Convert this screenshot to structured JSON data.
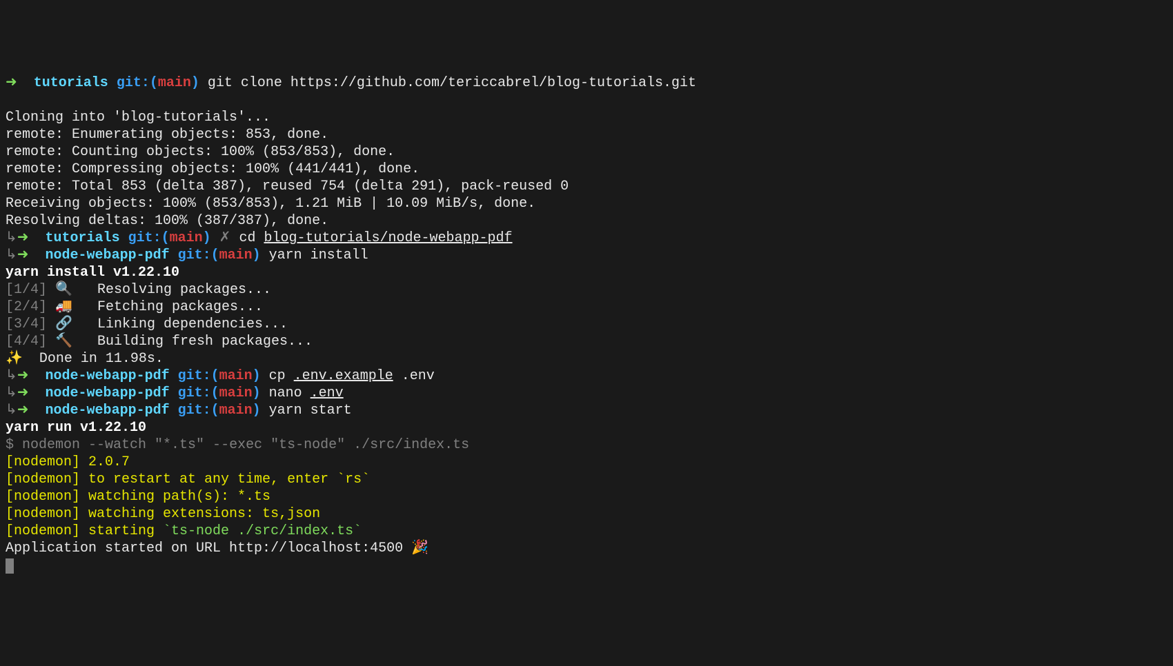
{
  "prompts": [
    {
      "arrow": "➜",
      "dir": "tutorials",
      "gitLabel": "git:(",
      "branch": "main",
      "gitClose": ")",
      "command": "git clone https://github.com/tericcabrel/blog-tutorials.git"
    },
    {
      "arrow": "➜",
      "dir": "tutorials",
      "gitLabel": "git:(",
      "branch": "main",
      "gitClose": ")",
      "cross": "✗",
      "command": "cd ",
      "commandUnderline": "blog-tutorials/node-webapp-pdf"
    },
    {
      "arrow": "➜",
      "dir": "node-webapp-pdf",
      "gitLabel": "git:(",
      "branch": "main",
      "gitClose": ")",
      "command": "yarn install"
    },
    {
      "arrow": "➜",
      "dir": "node-webapp-pdf",
      "gitLabel": "git:(",
      "branch": "main",
      "gitClose": ")",
      "command": "cp ",
      "commandUnderline": ".env.example",
      "commandAfter": " .env"
    },
    {
      "arrow": "➜",
      "dir": "node-webapp-pdf",
      "gitLabel": "git:(",
      "branch": "main",
      "gitClose": ")",
      "command": "nano ",
      "commandUnderline": ".env"
    },
    {
      "arrow": "➜",
      "dir": "node-webapp-pdf",
      "gitLabel": "git:(",
      "branch": "main",
      "gitClose": ")",
      "command": "yarn start"
    }
  ],
  "blank": "",
  "cloneOutput": {
    "l1": "Cloning into 'blog-tutorials'...",
    "l2": "remote: Enumerating objects: 853, done.",
    "l3": "remote: Counting objects: 100% (853/853), done.",
    "l4": "remote: Compressing objects: 100% (441/441), done.",
    "l5": "remote: Total 853 (delta 387), reused 754 (delta 291), pack-reused 0",
    "l6": "Receiving objects: 100% (853/853), 1.21 MiB | 10.09 MiB/s, done.",
    "l7": "Resolving deltas: 100% (387/387), done."
  },
  "yarnInstall": {
    "header": "yarn install v1.22.10",
    "steps": [
      {
        "num": "[1/4]",
        "emoji": "🔍 ",
        "text": " Resolving packages..."
      },
      {
        "num": "[2/4]",
        "emoji": "🚚 ",
        "text": " Fetching packages..."
      },
      {
        "num": "[3/4]",
        "emoji": "🔗 ",
        "text": " Linking dependencies..."
      },
      {
        "num": "[4/4]",
        "emoji": "🔨 ",
        "text": " Building fresh packages..."
      }
    ],
    "done": "✨  Done in 11.98s."
  },
  "yarnStart": {
    "header": "yarn run v1.22.10",
    "dollar": "$ ",
    "cmd": "nodemon --watch \"*.ts\" --exec \"ts-node\" ./src/index.ts"
  },
  "nodemon": {
    "l1": "[nodemon] 2.0.7",
    "l2": "[nodemon] to restart at any time, enter `rs`",
    "l3": "[nodemon] watching path(s): *.ts",
    "l4": "[nodemon] watching extensions: ts,json",
    "l5a": "[nodemon] starting ",
    "l5b": "`ts-node ./src/index.ts`"
  },
  "appStarted": "Application started on URL http://localhost:4500 🎉"
}
